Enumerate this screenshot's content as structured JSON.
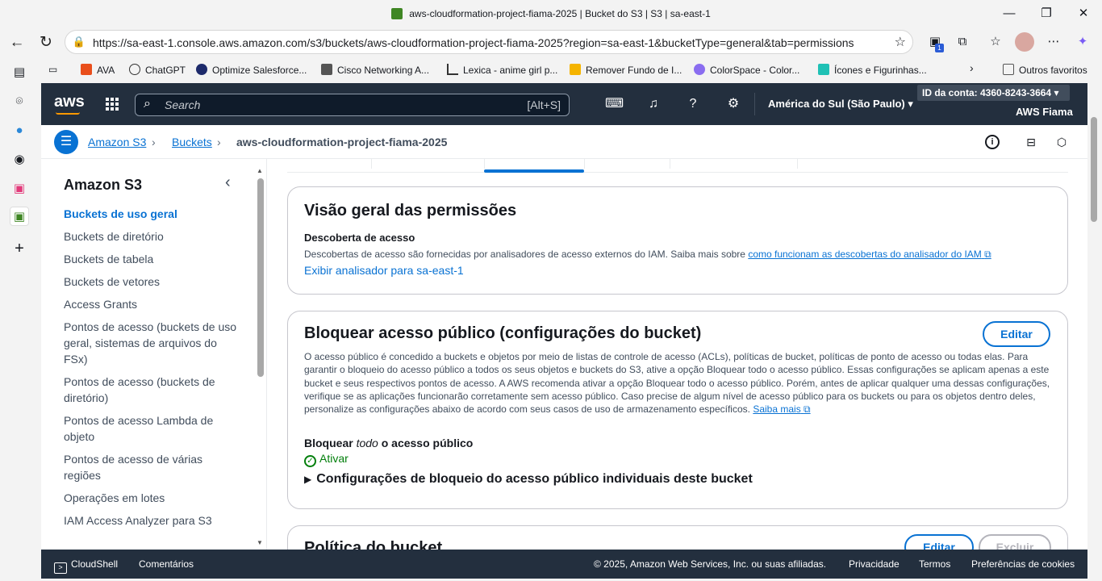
{
  "window": {
    "title": "aws-cloudformation-project-fiama-2025 | Bucket do S3 | S3 | sa-east-1"
  },
  "browser": {
    "url": "https://sa-east-1.console.aws.amazon.com/s3/buckets/aws-cloudformation-project-fiama-2025?region=sa-east-1&bucketType=general&tab=permissions",
    "extension_badge": "1",
    "bookmarks": [
      "AVA",
      "ChatGPT",
      "Optimize Salesforce...",
      "Cisco Networking A...",
      "Lexica - anime girl p...",
      "Remover Fundo de I...",
      "ColorSpace - Color...",
      "Ícones e Figurinhas...",
      "Outros favoritos"
    ]
  },
  "aws": {
    "logo": "aws",
    "search_placeholder": "Search",
    "search_shortcut": "[Alt+S]",
    "region": "América do Sul (São Paulo)",
    "account_id": "ID da conta: 4360-8243-3664",
    "account_name": "AWS Fiama"
  },
  "breadcrumb": {
    "items": [
      "Amazon S3",
      "Buckets",
      "aws-cloudformation-project-fiama-2025"
    ]
  },
  "nav": {
    "title": "Amazon S3",
    "items": [
      "Buckets de uso geral",
      "Buckets de diretório",
      "Buckets de tabela",
      "Buckets de vetores",
      "Access Grants",
      "Pontos de acesso (buckets de uso geral, sistemas de arquivos do FSx)",
      "Pontos de acesso (buckets de diretório)",
      "Pontos de acesso Lambda de objeto",
      "Pontos de acesso de várias regiões",
      "Operações em lotes",
      "IAM Access Analyzer para S3"
    ]
  },
  "overview": {
    "title": "Visão geral das permissões",
    "subtitle": "Descoberta de acesso",
    "text": "Descobertas de acesso são fornecidas por analisadores de acesso externos do IAM. Saiba mais sobre",
    "link": "como funcionam as descobertas do analisador do IAM",
    "analyzer_link": "Exibir analisador para sa-east-1"
  },
  "block": {
    "title": "Bloquear acesso público (configurações do bucket)",
    "edit_label": "Editar",
    "text": "O acesso público é concedido a buckets e objetos por meio de listas de controle de acesso (ACLs), políticas de bucket, políticas de ponto de acesso ou todas elas. Para garantir o bloqueio do acesso público a todos os seus objetos e buckets do S3, ative a opção Bloquear todo o acesso público. Essas configurações se aplicam apenas a este bucket e seus respectivos pontos de acesso. A AWS recomenda ativar a opção Bloquear todo o acesso público. Porém, antes de aplicar qualquer uma dessas configurações, verifique se as aplicações funcionarão corretamente sem acesso público. Caso precise de algum nível de acesso público para os buckets ou para os objetos dentro deles, personalize as configurações abaixo de acordo com seus casos de uso de armazenamento específicos.",
    "learn_more": "Saiba mais",
    "setting_prefix": "Bloquear",
    "setting_emph": "todo",
    "setting_suffix": "o acesso público",
    "status": "Ativar",
    "expand_label": "Configurações de bloqueio do acesso público individuais deste bucket"
  },
  "policy": {
    "title": "Política do bucket",
    "edit_label": "Editar",
    "delete_label": "Excluir"
  },
  "footer": {
    "cloudshell": "CloudShell",
    "feedback": "Comentários",
    "copyright": "© 2025, Amazon Web Services, Inc. ou suas afiliadas.",
    "privacy": "Privacidade",
    "terms": "Termos",
    "cookies": "Preferências de cookies"
  },
  "colors": {
    "aws_nav": "#232f3e",
    "link": "#0972d3",
    "success": "#037f0c",
    "border": "#c6c6cd"
  }
}
